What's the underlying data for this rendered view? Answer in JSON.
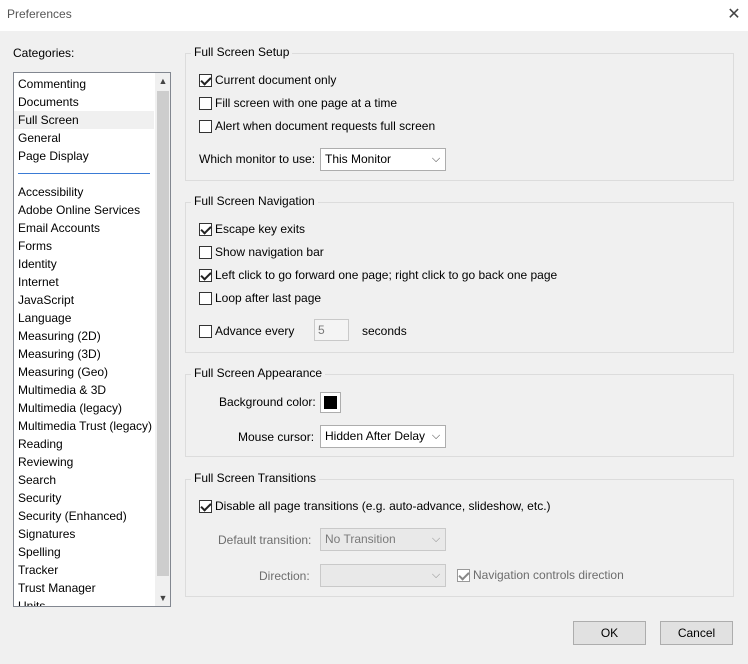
{
  "window": {
    "title": "Preferences",
    "close_glyph": "✕"
  },
  "categories": {
    "label": "Categories:",
    "group1": [
      "Commenting",
      "Documents",
      "Full Screen",
      "General",
      "Page Display"
    ],
    "group2": [
      "Accessibility",
      "Adobe Online Services",
      "Email Accounts",
      "Forms",
      "Identity",
      "Internet",
      "JavaScript",
      "Language",
      "Measuring (2D)",
      "Measuring (3D)",
      "Measuring (Geo)",
      "Multimedia & 3D",
      "Multimedia (legacy)",
      "Multimedia Trust (legacy)",
      "Reading",
      "Reviewing",
      "Search",
      "Security",
      "Security (Enhanced)",
      "Signatures",
      "Spelling",
      "Tracker",
      "Trust Manager",
      "Units"
    ],
    "selected": "Full Screen"
  },
  "setup": {
    "title": "Full Screen Setup",
    "current_doc_only": "Current document only",
    "fill_one_page": "Fill screen with one page at a time",
    "alert_fullscreen": "Alert when document requests full screen",
    "monitor_label": "Which monitor to use:",
    "monitor_value": "This Monitor"
  },
  "navigation": {
    "title": "Full Screen Navigation",
    "escape_exits": "Escape key exits",
    "show_nav_bar": "Show navigation bar",
    "left_click": "Left click to go forward one page; right click to go back one page",
    "loop_after_last": "Loop after last page",
    "advance_every": "Advance every",
    "advance_value": "5",
    "seconds": "seconds"
  },
  "appearance": {
    "title": "Full Screen Appearance",
    "bg_color_label": "Background color:",
    "bg_color": "#000000",
    "mouse_cursor_label": "Mouse cursor:",
    "mouse_cursor_value": "Hidden After Delay"
  },
  "transitions": {
    "title": "Full Screen Transitions",
    "disable_all": "Disable all page transitions (e.g. auto-advance, slideshow, etc.)",
    "default_transition_label": "Default transition:",
    "default_transition_value": "No Transition",
    "direction_label": "Direction:",
    "direction_value": "",
    "nav_controls_direction": "Navigation controls direction"
  },
  "buttons": {
    "ok": "OK",
    "cancel": "Cancel"
  }
}
